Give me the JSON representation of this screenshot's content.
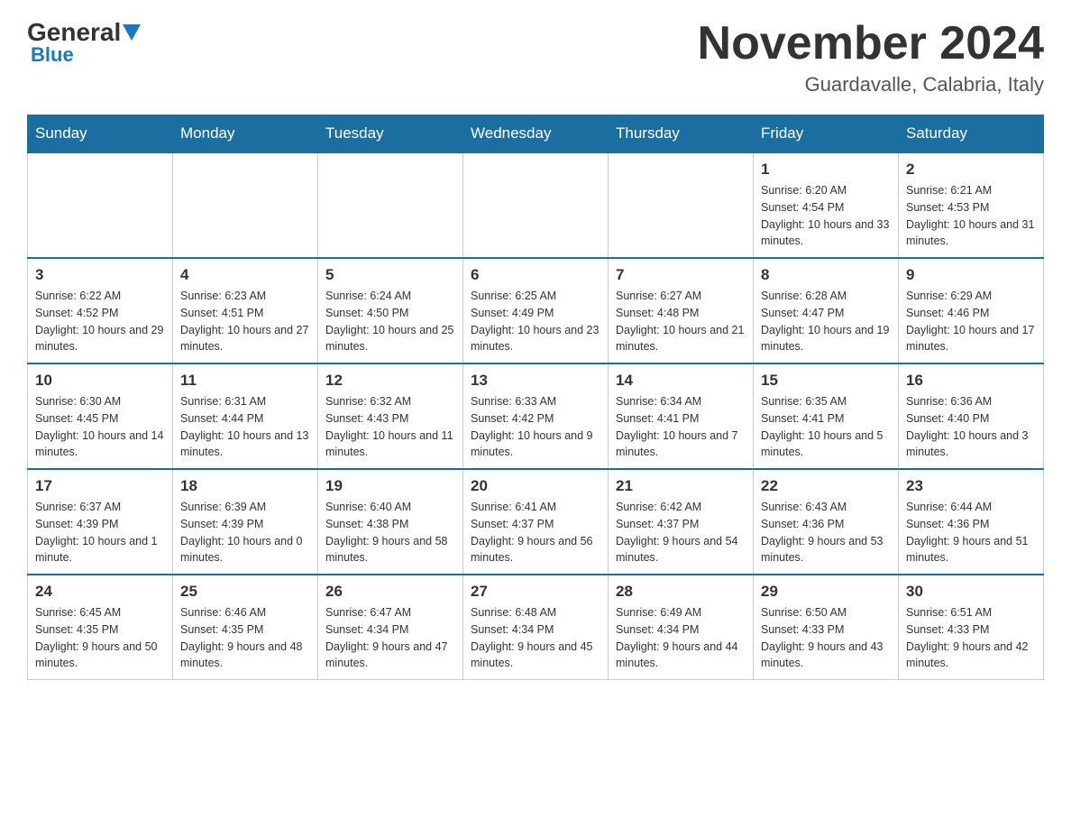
{
  "logo": {
    "general": "General",
    "blue": "Blue"
  },
  "header": {
    "month": "November 2024",
    "location": "Guardavalle, Calabria, Italy"
  },
  "weekdays": [
    "Sunday",
    "Monday",
    "Tuesday",
    "Wednesday",
    "Thursday",
    "Friday",
    "Saturday"
  ],
  "weeks": [
    [
      {
        "day": "",
        "info": ""
      },
      {
        "day": "",
        "info": ""
      },
      {
        "day": "",
        "info": ""
      },
      {
        "day": "",
        "info": ""
      },
      {
        "day": "",
        "info": ""
      },
      {
        "day": "1",
        "info": "Sunrise: 6:20 AM\nSunset: 4:54 PM\nDaylight: 10 hours and 33 minutes."
      },
      {
        "day": "2",
        "info": "Sunrise: 6:21 AM\nSunset: 4:53 PM\nDaylight: 10 hours and 31 minutes."
      }
    ],
    [
      {
        "day": "3",
        "info": "Sunrise: 6:22 AM\nSunset: 4:52 PM\nDaylight: 10 hours and 29 minutes."
      },
      {
        "day": "4",
        "info": "Sunrise: 6:23 AM\nSunset: 4:51 PM\nDaylight: 10 hours and 27 minutes."
      },
      {
        "day": "5",
        "info": "Sunrise: 6:24 AM\nSunset: 4:50 PM\nDaylight: 10 hours and 25 minutes."
      },
      {
        "day": "6",
        "info": "Sunrise: 6:25 AM\nSunset: 4:49 PM\nDaylight: 10 hours and 23 minutes."
      },
      {
        "day": "7",
        "info": "Sunrise: 6:27 AM\nSunset: 4:48 PM\nDaylight: 10 hours and 21 minutes."
      },
      {
        "day": "8",
        "info": "Sunrise: 6:28 AM\nSunset: 4:47 PM\nDaylight: 10 hours and 19 minutes."
      },
      {
        "day": "9",
        "info": "Sunrise: 6:29 AM\nSunset: 4:46 PM\nDaylight: 10 hours and 17 minutes."
      }
    ],
    [
      {
        "day": "10",
        "info": "Sunrise: 6:30 AM\nSunset: 4:45 PM\nDaylight: 10 hours and 14 minutes."
      },
      {
        "day": "11",
        "info": "Sunrise: 6:31 AM\nSunset: 4:44 PM\nDaylight: 10 hours and 13 minutes."
      },
      {
        "day": "12",
        "info": "Sunrise: 6:32 AM\nSunset: 4:43 PM\nDaylight: 10 hours and 11 minutes."
      },
      {
        "day": "13",
        "info": "Sunrise: 6:33 AM\nSunset: 4:42 PM\nDaylight: 10 hours and 9 minutes."
      },
      {
        "day": "14",
        "info": "Sunrise: 6:34 AM\nSunset: 4:41 PM\nDaylight: 10 hours and 7 minutes."
      },
      {
        "day": "15",
        "info": "Sunrise: 6:35 AM\nSunset: 4:41 PM\nDaylight: 10 hours and 5 minutes."
      },
      {
        "day": "16",
        "info": "Sunrise: 6:36 AM\nSunset: 4:40 PM\nDaylight: 10 hours and 3 minutes."
      }
    ],
    [
      {
        "day": "17",
        "info": "Sunrise: 6:37 AM\nSunset: 4:39 PM\nDaylight: 10 hours and 1 minute."
      },
      {
        "day": "18",
        "info": "Sunrise: 6:39 AM\nSunset: 4:39 PM\nDaylight: 10 hours and 0 minutes."
      },
      {
        "day": "19",
        "info": "Sunrise: 6:40 AM\nSunset: 4:38 PM\nDaylight: 9 hours and 58 minutes."
      },
      {
        "day": "20",
        "info": "Sunrise: 6:41 AM\nSunset: 4:37 PM\nDaylight: 9 hours and 56 minutes."
      },
      {
        "day": "21",
        "info": "Sunrise: 6:42 AM\nSunset: 4:37 PM\nDaylight: 9 hours and 54 minutes."
      },
      {
        "day": "22",
        "info": "Sunrise: 6:43 AM\nSunset: 4:36 PM\nDaylight: 9 hours and 53 minutes."
      },
      {
        "day": "23",
        "info": "Sunrise: 6:44 AM\nSunset: 4:36 PM\nDaylight: 9 hours and 51 minutes."
      }
    ],
    [
      {
        "day": "24",
        "info": "Sunrise: 6:45 AM\nSunset: 4:35 PM\nDaylight: 9 hours and 50 minutes."
      },
      {
        "day": "25",
        "info": "Sunrise: 6:46 AM\nSunset: 4:35 PM\nDaylight: 9 hours and 48 minutes."
      },
      {
        "day": "26",
        "info": "Sunrise: 6:47 AM\nSunset: 4:34 PM\nDaylight: 9 hours and 47 minutes."
      },
      {
        "day": "27",
        "info": "Sunrise: 6:48 AM\nSunset: 4:34 PM\nDaylight: 9 hours and 45 minutes."
      },
      {
        "day": "28",
        "info": "Sunrise: 6:49 AM\nSunset: 4:34 PM\nDaylight: 9 hours and 44 minutes."
      },
      {
        "day": "29",
        "info": "Sunrise: 6:50 AM\nSunset: 4:33 PM\nDaylight: 9 hours and 43 minutes."
      },
      {
        "day": "30",
        "info": "Sunrise: 6:51 AM\nSunset: 4:33 PM\nDaylight: 9 hours and 42 minutes."
      }
    ]
  ]
}
